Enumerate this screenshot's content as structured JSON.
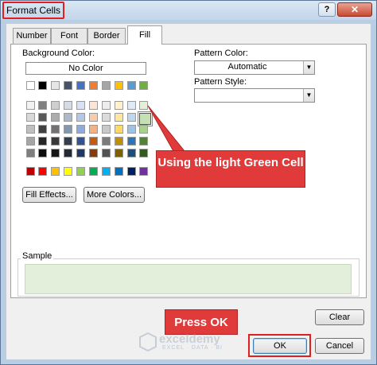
{
  "window": {
    "title": "Format Cells",
    "help": "?",
    "close": "✕"
  },
  "tabs": [
    {
      "label": "Number"
    },
    {
      "label": "Font"
    },
    {
      "label": "Border"
    },
    {
      "label": "Fill"
    }
  ],
  "fill": {
    "background_color_label": "Background Color:",
    "no_color": "No Color",
    "fill_effects": "Fill Effects...",
    "more_colors": "More Colors...",
    "pattern_color_label": "Pattern Color:",
    "pattern_color_value": "Automatic",
    "pattern_style_label": "Pattern Style:",
    "pattern_style_value": "",
    "sample_label": "Sample",
    "sample_color": "#e3efda",
    "selected_swatch": {
      "row": 2,
      "col": 10
    }
  },
  "palette": {
    "theme": [
      [
        "#ffffff",
        "#000000",
        "#e7e6e6",
        "#44546a",
        "#4472c4",
        "#ed7d31",
        "#a5a5a5",
        "#ffc000",
        "#5b9bd5",
        "#70ad47"
      ],
      [
        "#f2f2f2",
        "#808080",
        "#d0cece",
        "#d6dce5",
        "#d9e2f3",
        "#fbe5d6",
        "#ededed",
        "#fff2cc",
        "#deebf7",
        "#e2f0d9"
      ],
      [
        "#d9d9d9",
        "#595959",
        "#aeabab",
        "#adb9ca",
        "#b4c7e7",
        "#f8cbad",
        "#dbdbdb",
        "#ffe699",
        "#bdd7ee",
        "#c5e0b4"
      ],
      [
        "#bfbfbf",
        "#404040",
        "#757171",
        "#8497b0",
        "#8faadc",
        "#f4b183",
        "#c9c9c9",
        "#ffd966",
        "#9dc3e6",
        "#a9d18e"
      ],
      [
        "#a6a6a6",
        "#262626",
        "#3b3838",
        "#333f50",
        "#2f5597",
        "#c55a11",
        "#7b7b7b",
        "#bf9000",
        "#2e75b6",
        "#548235"
      ],
      [
        "#7f7f7f",
        "#0d0d0d",
        "#171616",
        "#222a35",
        "#1f3864",
        "#843c0c",
        "#525252",
        "#7f6000",
        "#1f4e79",
        "#385723"
      ]
    ],
    "standard": [
      "#c00000",
      "#ff0000",
      "#ffc000",
      "#ffff00",
      "#92d050",
      "#00b050",
      "#00b0f0",
      "#0070c0",
      "#002060",
      "#7030a0"
    ]
  },
  "buttons": {
    "clear": "Clear",
    "ok": "OK",
    "cancel": "Cancel"
  },
  "annotations": {
    "green_cell": "Using the light Green Cell",
    "press_ok": "Press OK"
  },
  "watermark": {
    "name": "exceldemy",
    "tagline": "EXCEL · DATA · BI"
  }
}
